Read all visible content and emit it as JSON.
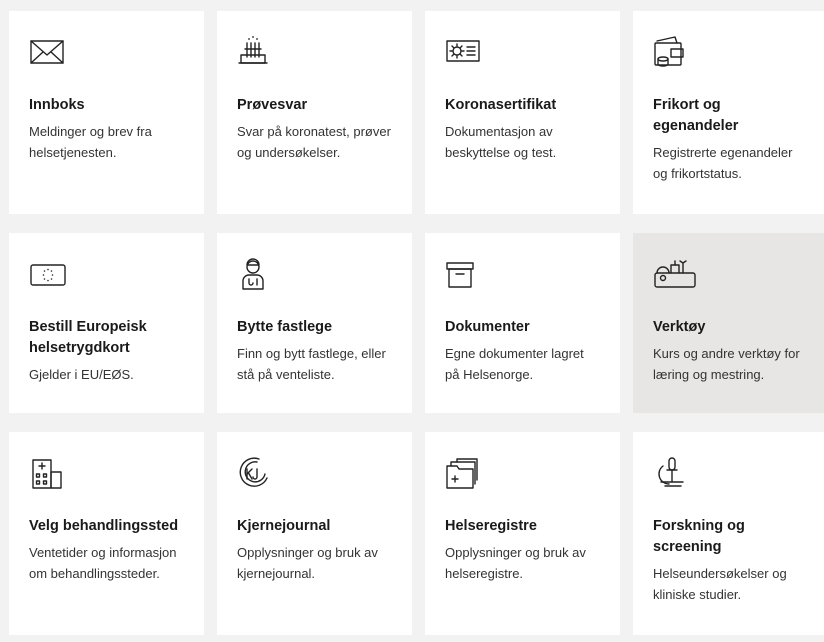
{
  "cards": [
    {
      "title": "Innboks",
      "desc": "Meldinger og brev fra helsetjenesten.",
      "icon": "envelope-icon"
    },
    {
      "title": "Prøvesvar",
      "desc": "Svar på koronatest, prøver og undersøkelser.",
      "icon": "test-tubes-icon"
    },
    {
      "title": "Koronasertifikat",
      "desc": "Dokumentasjon av beskyttelse og test.",
      "icon": "certificate-icon"
    },
    {
      "title": "Frikort og egenandeler",
      "desc": "Registrerte egenandeler og frikortstatus.",
      "icon": "wallet-icon"
    },
    {
      "title": "Bestill Europeisk helsetrygdkort",
      "desc": "Gjelder i EU/EØS.",
      "icon": "eu-card-icon"
    },
    {
      "title": "Bytte fastlege",
      "desc": "Finn og bytt fastlege, eller stå på venteliste.",
      "icon": "doctor-icon"
    },
    {
      "title": "Dokumenter",
      "desc": "Egne dokumenter lagret på Helsenorge.",
      "icon": "archive-box-icon"
    },
    {
      "title": "Verktøy",
      "desc": "Kurs og andre verktøy for læring og mestring.",
      "icon": "toolbox-icon"
    },
    {
      "title": "Velg behandlingssted",
      "desc": "Ventetider og informasjon om behandlingssteder.",
      "icon": "hospital-icon"
    },
    {
      "title": "Kjernejournal",
      "desc": "Opplysninger og bruk av kjernejournal.",
      "icon": "kj-logo-icon"
    },
    {
      "title": "Helseregistre",
      "desc": "Opplysninger og bruk av helseregistre.",
      "icon": "folder-add-icon"
    },
    {
      "title": "Forskning og screening",
      "desc": "Helseundersøkelser og kliniske studier.",
      "icon": "microscope-icon"
    }
  ]
}
